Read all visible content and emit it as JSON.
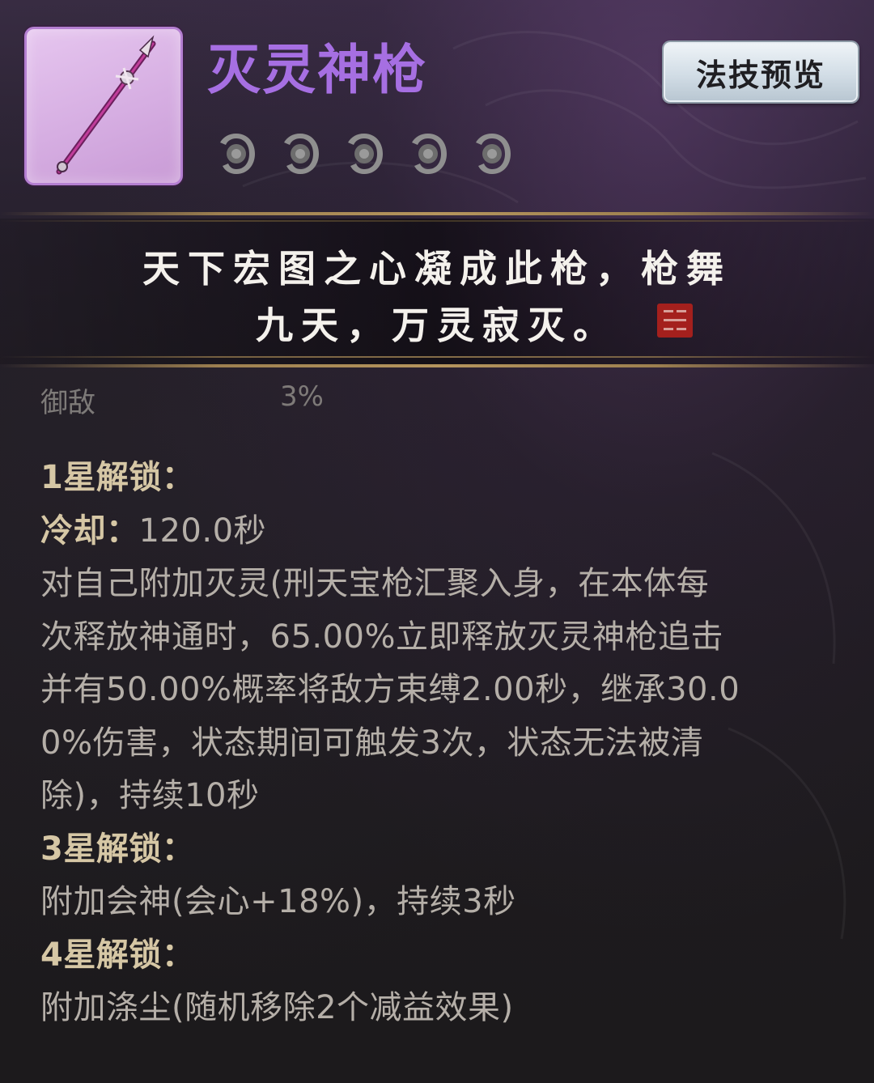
{
  "item": {
    "name": "灭灵神枪",
    "icon": "spear-icon",
    "rarity_color": "#a66fe2",
    "star_count": 5,
    "star_icon": "star-slot-icon"
  },
  "preview_button": {
    "label": "法技预览"
  },
  "flavor": {
    "line1": "天下宏图之心凝成此枪，枪舞",
    "line2": "九天，万灵寂灭。",
    "seal_icon": "red-seal-icon"
  },
  "partial_stat": {
    "name": "御敌",
    "value": "3%"
  },
  "description": {
    "lines": [
      {
        "text": "1星解锁："
      },
      {
        "label": "冷却：",
        "text": "120.0秒"
      },
      {
        "text": "对自己附加灭灵(刑天宝枪汇聚入身，在本体每"
      },
      {
        "text": "次释放神通时，65.00%立即释放灭灵神枪追击"
      },
      {
        "text": "并有50.00%概率将敌方束缚2.00秒，继承30.0"
      },
      {
        "text": "0%伤害，状态期间可触发3次，状态无法被清"
      },
      {
        "text": "除)，持续10秒"
      },
      {
        "text": "3星解锁："
      },
      {
        "text": "附加会神(会心+18%)，持续3秒"
      },
      {
        "text": "4星解锁："
      },
      {
        "text": "附加涤尘(随机移除2个减益效果)"
      }
    ]
  },
  "colors": {
    "heading": "#d6c7a5",
    "body_text": "#b5afa8",
    "divider": "#b5955d"
  }
}
